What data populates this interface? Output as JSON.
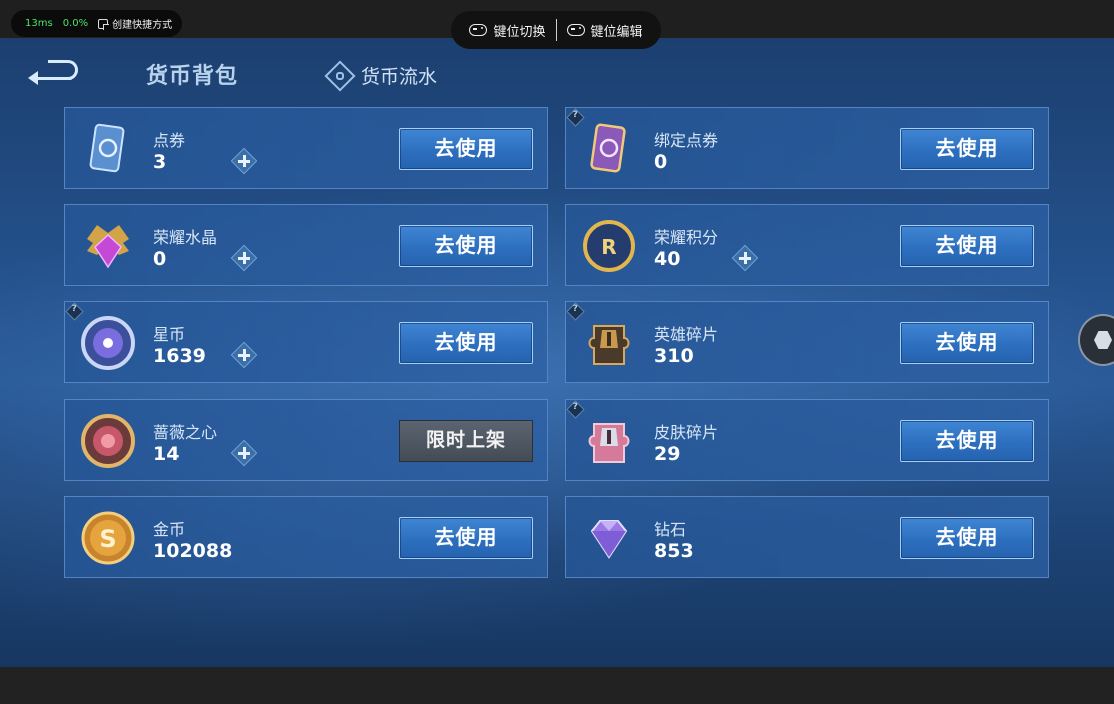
{
  "emulator": {
    "latency": "13ms",
    "loss": "0.0%",
    "shortcut_label": "创建快捷方式",
    "key_switch_label": "键位切换",
    "key_edit_label": "键位编辑"
  },
  "header": {
    "active_tab": "货币背包",
    "flow_tab": "货币流水"
  },
  "currencies": [
    {
      "name": "点券",
      "amount": "3",
      "action": "去使用",
      "has_plus": true,
      "has_help": false,
      "icon": "coupon-card-icon"
    },
    {
      "name": "绑定点券",
      "amount": "0",
      "action": "去使用",
      "has_plus": false,
      "has_help": true,
      "icon": "bound-coupon-card-icon"
    },
    {
      "name": "荣耀水晶",
      "amount": "0",
      "action": "去使用",
      "has_plus": true,
      "has_help": false,
      "icon": "glory-crystal-icon"
    },
    {
      "name": "荣耀积分",
      "amount": "40",
      "action": "去使用",
      "has_plus": true,
      "has_help": false,
      "icon": "glory-points-icon"
    },
    {
      "name": "星币",
      "amount": "1639",
      "action": "去使用",
      "has_plus": true,
      "has_help": true,
      "icon": "star-coin-icon"
    },
    {
      "name": "英雄碎片",
      "amount": "310",
      "action": "去使用",
      "has_plus": false,
      "has_help": true,
      "icon": "hero-fragment-icon"
    },
    {
      "name": "蔷薇之心",
      "amount": "14",
      "action": "限时上架",
      "has_plus": true,
      "has_help": false,
      "icon": "rose-heart-icon"
    },
    {
      "name": "皮肤碎片",
      "amount": "29",
      "action": "去使用",
      "has_plus": false,
      "has_help": true,
      "icon": "skin-fragment-icon"
    },
    {
      "name": "金币",
      "amount": "102088",
      "action": "去使用",
      "has_plus": false,
      "has_help": false,
      "icon": "gold-coin-icon"
    },
    {
      "name": "钻石",
      "amount": "853",
      "action": "去使用",
      "has_plus": false,
      "has_help": false,
      "icon": "diamond-icon"
    }
  ],
  "help_mark": "?"
}
